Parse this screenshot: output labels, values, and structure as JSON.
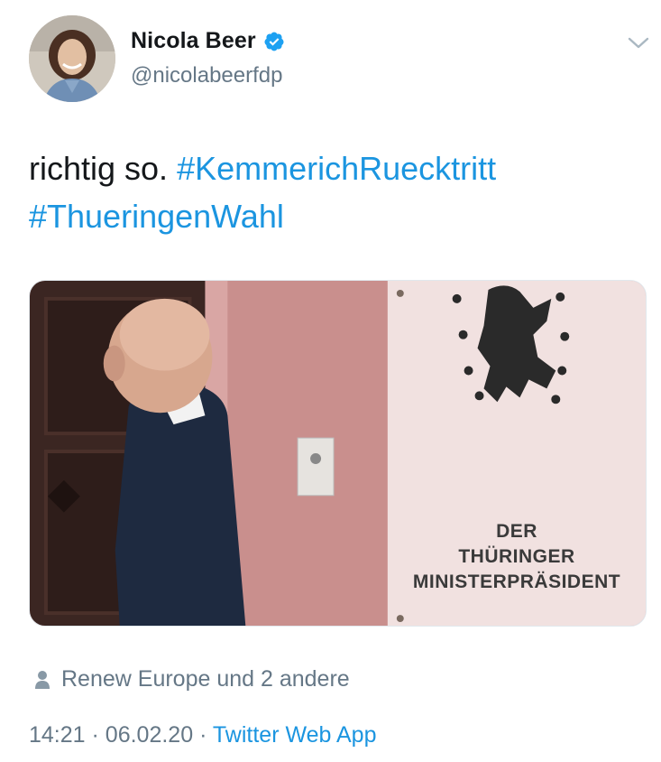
{
  "author": {
    "name": "Nicola Beer",
    "handle": "@nicolabeerfdp",
    "verified_icon": "verified-badge-icon",
    "avatar_icon": "avatar"
  },
  "tweet": {
    "text_plain": "richtig so. ",
    "hashtags": [
      "#KemmerichRuecktritt",
      "#ThueringenWahl"
    ]
  },
  "media": {
    "sign_lines": [
      "DER",
      "THÜRINGER",
      "MINISTERPRÄSIDENT"
    ]
  },
  "engagement": {
    "liked_by": "Renew Europe und 2 andere"
  },
  "meta": {
    "time": "14:21",
    "separator": "·",
    "date": "06.02.20",
    "source": "Twitter Web App"
  },
  "colors": {
    "link": "#1b95e0",
    "secondary": "#657786",
    "primary": "#14171a"
  }
}
